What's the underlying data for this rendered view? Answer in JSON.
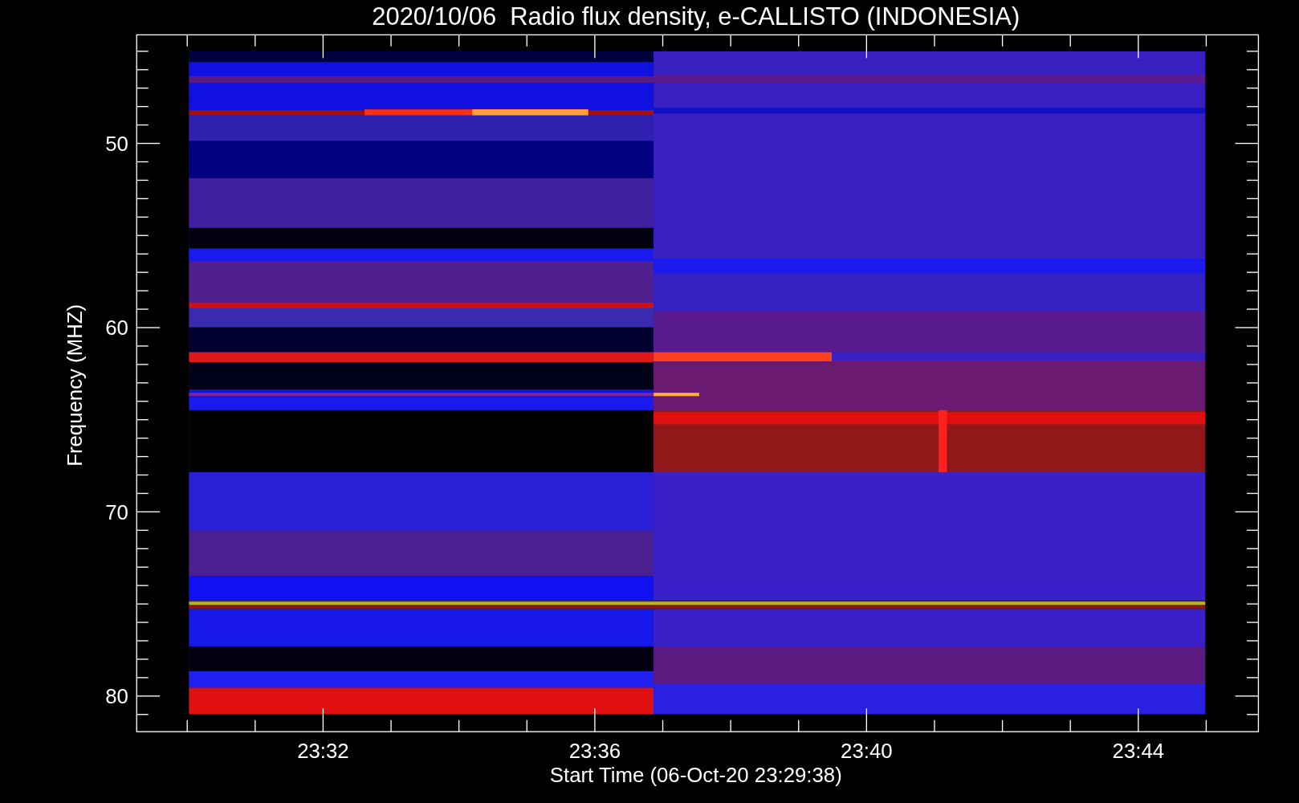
{
  "title": "2020/10/06  Radio flux density, e-CALLISTO (INDONESIA)",
  "y_axis": {
    "label": "Frequency (MHZ)",
    "ticks": [
      "50",
      "60",
      "70",
      "80"
    ]
  },
  "x_axis": {
    "label": "Start Time (06-Oct-20 23:29:38)",
    "ticks": [
      "23:32",
      "23:36",
      "23:40",
      "23:44"
    ]
  }
}
